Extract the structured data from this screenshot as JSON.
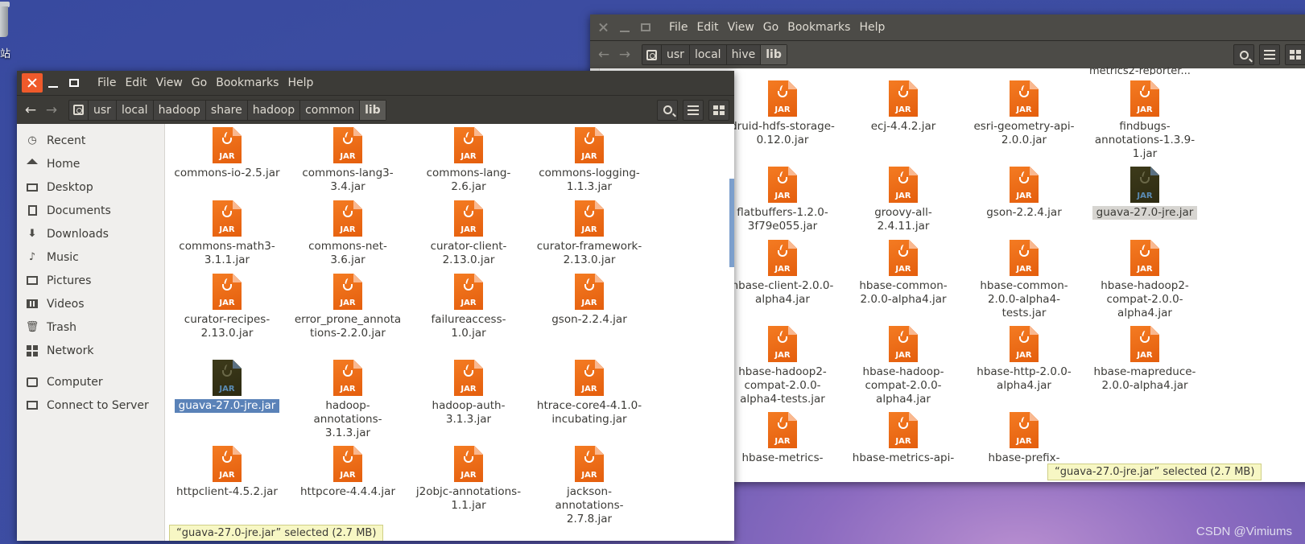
{
  "desktop": {
    "label": "站",
    "watermark": "CSDN @Vimiums"
  },
  "menu": [
    "File",
    "Edit",
    "View",
    "Go",
    "Bookmarks",
    "Help"
  ],
  "window_left": {
    "path": [
      "usr",
      "local",
      "hadoop",
      "share",
      "hadoop",
      "common",
      "lib"
    ],
    "sidebar": {
      "places": [
        {
          "label": "Recent",
          "icon": "clock-icon"
        },
        {
          "label": "Home",
          "icon": "home-icon"
        },
        {
          "label": "Desktop",
          "icon": "desktop-icon"
        },
        {
          "label": "Documents",
          "icon": "documents-icon"
        },
        {
          "label": "Downloads",
          "icon": "download-icon"
        },
        {
          "label": "Music",
          "icon": "music-icon"
        },
        {
          "label": "Pictures",
          "icon": "pictures-icon"
        },
        {
          "label": "Videos",
          "icon": "videos-icon"
        },
        {
          "label": "Trash",
          "icon": "trash-icon"
        },
        {
          "label": "Network",
          "icon": "network-icon"
        }
      ],
      "devices": [
        {
          "label": "Computer",
          "icon": "computer-icon"
        },
        {
          "label": "Connect to Server",
          "icon": "server-icon"
        }
      ]
    },
    "files": [
      "commons-io-2.5.jar",
      "commons-lang3-3.4.jar",
      "commons-lang-2.6.jar",
      "commons-logging-1.1.3.jar",
      "commons-math3-3.1.1.jar",
      "commons-net-3.6.jar",
      "curator-client-2.13.0.jar",
      "curator-framework-2.13.0.jar",
      "curator-recipes-2.13.0.jar",
      "error_prone_annotations-2.2.0.jar",
      "failureaccess-1.0.jar",
      "gson-2.2.4.jar",
      "guava-27.0-jre.jar",
      "hadoop-annotations-3.1.3.jar",
      "hadoop-auth-3.1.3.jar",
      "htrace-core4-4.1.0-incubating.jar",
      "httpclient-4.5.2.jar",
      "httpcore-4.4.4.jar",
      "j2objc-annotations-1.1.jar",
      "jackson-annotations-2.7.8.jar"
    ],
    "selected_index": 12,
    "status": "“guava-27.0-jre.jar” selected  (2.7 MB)"
  },
  "window_right": {
    "path": [
      "usr",
      "local",
      "hive",
      "lib"
    ],
    "top_partial": "metrics2-reporter...",
    "files": [
      "druid-hdfs-storage-0.12.0.jar",
      "ecj-4.4.2.jar",
      "esri-geometry-api-2.0.0.jar",
      "findbugs-annotations-1.3.9-1.jar",
      "flatbuffers-1.2.0-3f79e055.jar",
      "groovy-all-2.4.11.jar",
      "gson-2.2.4.jar",
      "guava-27.0-jre.jar",
      "hbase-client-2.0.0-alpha4.jar",
      "hbase-common-2.0.0-alpha4.jar",
      "hbase-common-2.0.0-alpha4-tests.jar",
      "hbase-hadoop2-compat-2.0.0-alpha4.jar",
      "hbase-hadoop2-compat-2.0.0-alpha4-tests.jar",
      "hbase-hadoop-compat-2.0.0-alpha4.jar",
      "hbase-http-2.0.0-alpha4.jar",
      "hbase-mapreduce-2.0.0-alpha4.jar",
      "hbase-metrics-",
      "hbase-metrics-api-",
      "hbase-prefix-",
      ""
    ],
    "selected_index": 7,
    "status": "“guava-27.0-jre.jar” selected  (2.7 MB)"
  },
  "jar_label": "JAR"
}
